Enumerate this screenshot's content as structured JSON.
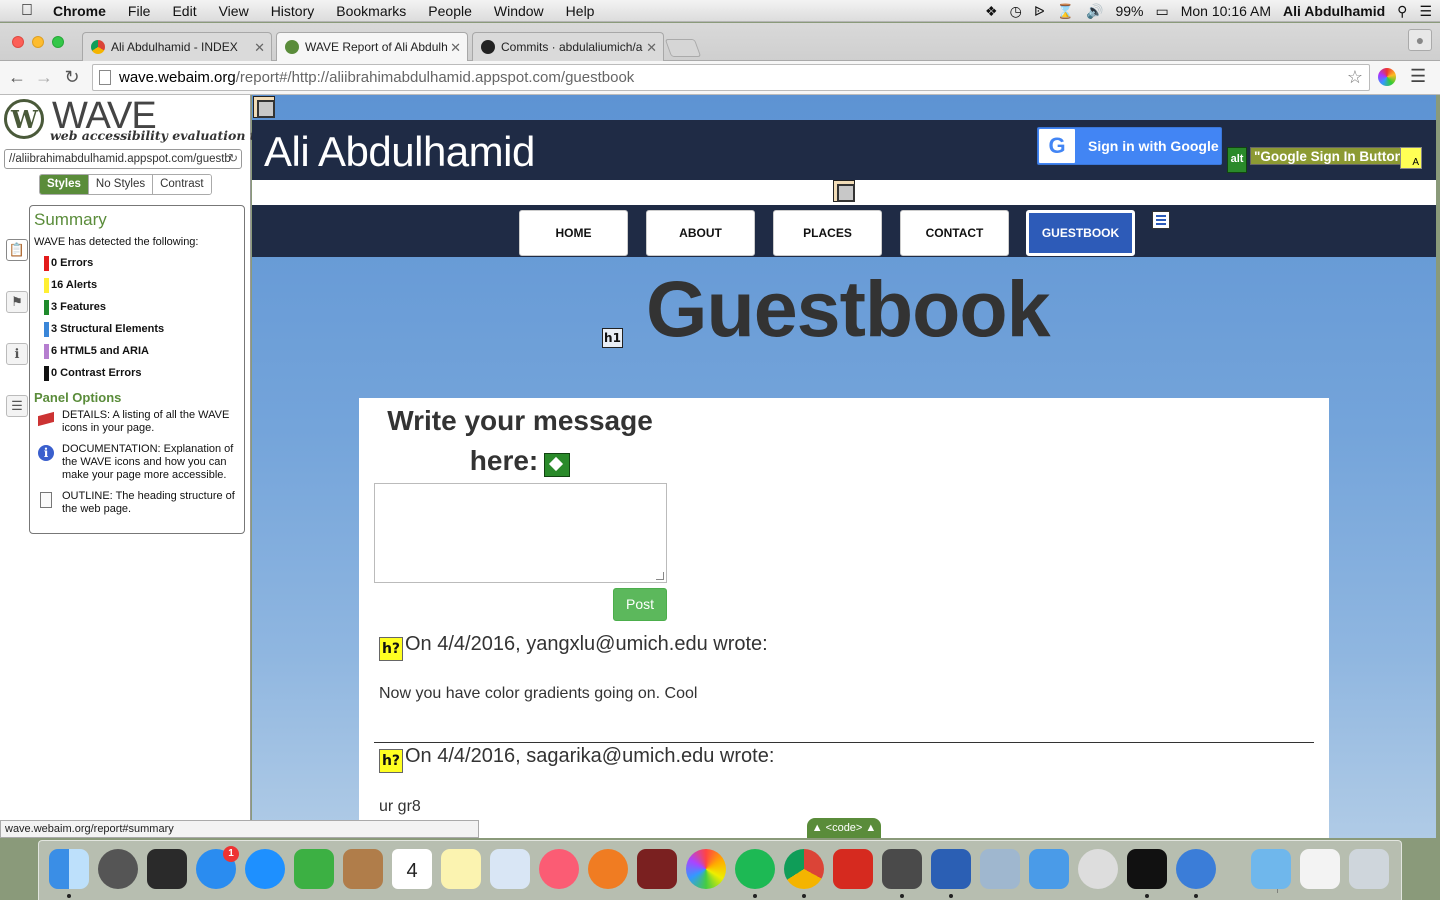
{
  "menubar": {
    "app": "Chrome",
    "items": [
      "File",
      "Edit",
      "View",
      "History",
      "Bookmarks",
      "People",
      "Window",
      "Help"
    ],
    "battery": "99%",
    "clock": "Mon 10:16 AM",
    "user": "Ali Abdulhamid"
  },
  "tabs": [
    {
      "label": "Ali Abdulhamid - INDEX",
      "icon": "chrome-icon",
      "color": "#f4b400"
    },
    {
      "label": "WAVE Report of Ali Abdulh",
      "icon": "wave-icon",
      "color": "#5a8c3a"
    },
    {
      "label": "Commits · abdulaliumich/a",
      "icon": "github-icon",
      "color": "#222222"
    }
  ],
  "toolbar": {
    "url_host": "wave.webaim.org",
    "url_path": "/report#/http://aliibrahimabdulhamid.appspot.com/guestbook"
  },
  "wave": {
    "title": "WAVE",
    "subtitle": "web accessibility evaluation tool",
    "url_value": "//aliibrahimabdulhamid.appspot.com/guestb",
    "view_tabs": [
      "Styles",
      "No Styles",
      "Contrast"
    ],
    "summary_title": "Summary",
    "summary_intro": "WAVE has detected the following:",
    "summary_items": [
      {
        "label": "0 Errors",
        "color": "#e31b1b"
      },
      {
        "label": "16 Alerts",
        "color": "#ffef33"
      },
      {
        "label": "3 Features",
        "color": "#1f8a2b"
      },
      {
        "label": "3 Structural Elements",
        "color": "#3a86d8"
      },
      {
        "label": "6 HTML5 and ARIA",
        "color": "#b57ecf"
      },
      {
        "label": "0 Contrast Errors",
        "color": "#111111"
      }
    ],
    "panel_options_title": "Panel Options",
    "options": [
      {
        "text": "DETAILS: A listing of all the WAVE icons in your page."
      },
      {
        "text": "DOCUMENTATION: Explanation of the WAVE icons and how you can make your page more accessible."
      },
      {
        "text": "OUTLINE: The heading structure of the web page."
      }
    ]
  },
  "site": {
    "title": "Ali Abdulhamid",
    "signin_label": "Sign in with Google",
    "alt_tag": "alt",
    "alt_text": "\"Google Sign In Button\"",
    "nav": [
      "HOME",
      "ABOUT",
      "PLACES",
      "CONTACT",
      "GUESTBOOK"
    ],
    "active_nav": "GUESTBOOK",
    "h1_tag": "h1",
    "heading": "Guestbook",
    "form_label": "Write your message here:",
    "textarea_value": "",
    "post_label": "Post",
    "h_tag": "h?",
    "entries": [
      {
        "header": "On 4/4/2016, yangxlu@umich.edu wrote:",
        "body": "Now you have color gradients going on. Cool"
      },
      {
        "header": "On 4/4/2016, sagarika@umich.edu wrote:",
        "body": "ur gr8"
      }
    ]
  },
  "statusbar": {
    "text": "wave.webaim.org/report#summary"
  },
  "code_toggle": "▲ <code> ▲",
  "dock": {
    "badge_app_store": "1",
    "calendar_day": "4"
  }
}
